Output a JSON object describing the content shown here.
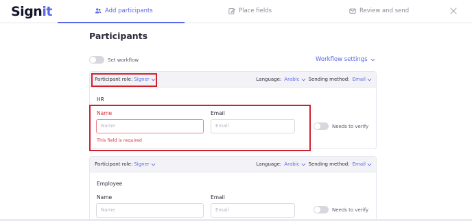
{
  "brand": {
    "name_main": "Sign",
    "name_accent": "it"
  },
  "steps": [
    {
      "label": "Add participants",
      "icon": "users-icon",
      "active": true
    },
    {
      "label": "Place fields",
      "icon": "edit-icon",
      "active": false
    },
    {
      "label": "Review and send",
      "icon": "mail-icon",
      "active": false
    }
  ],
  "page": {
    "title": "Participants",
    "workflow_toggle_label": "Set workflow",
    "workflow_settings_label": "Workflow settings"
  },
  "participants": [
    {
      "role_label": "Participant role:",
      "role_value": "Signer",
      "language_label": "Language:",
      "language_value": "Arabic",
      "sending_label": "Sending method:",
      "sending_value": "Email",
      "group_name": "HR",
      "name_label": "Name",
      "name_placeholder": "Name",
      "email_label": "Email",
      "email_placeholder": "Email",
      "error_text": "This field is required",
      "verify_label": "Needs to verify"
    },
    {
      "role_label": "Participant role:",
      "role_value": "Signer",
      "language_label": "Language:",
      "language_value": "Arabic",
      "sending_label": "Sending method:",
      "sending_value": "Email",
      "group_name": "Employee",
      "name_label": "Name",
      "name_placeholder": "Name",
      "email_label": "Email",
      "email_placeholder": "Email",
      "verify_label": "Needs to verify"
    }
  ],
  "colors": {
    "accent": "#5867e8",
    "error": "#d2303c",
    "highlight": "#d11f2c"
  }
}
